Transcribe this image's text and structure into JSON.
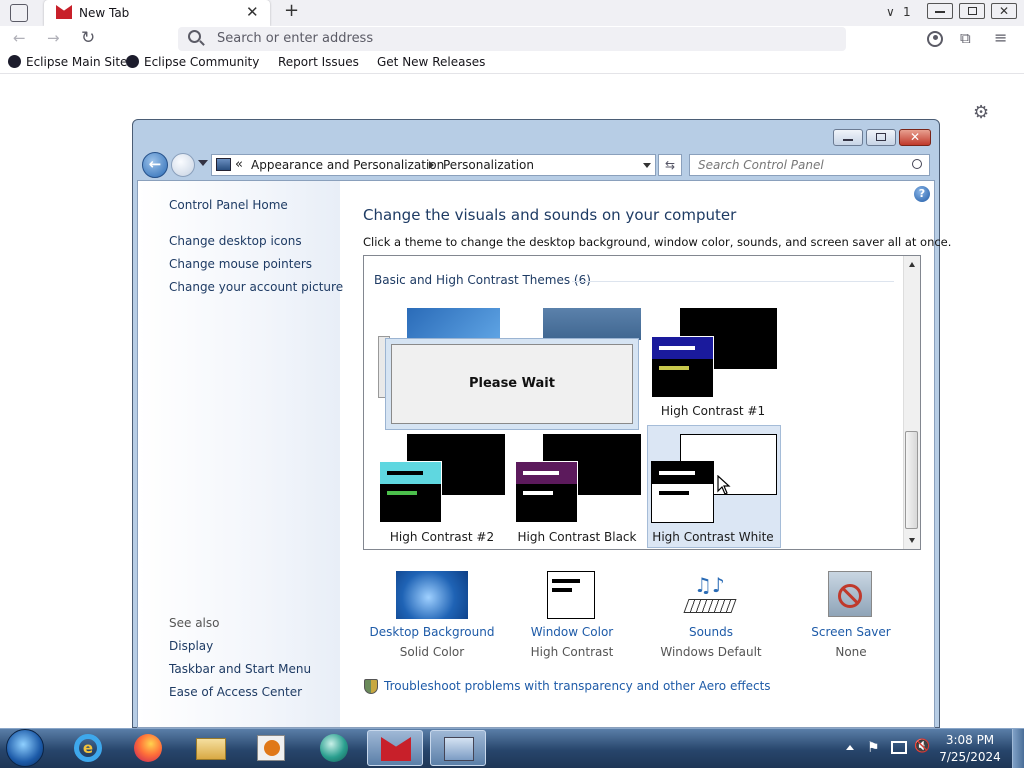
{
  "browser": {
    "tab_title": "New Tab",
    "tab_count": "1",
    "address_placeholder": "Search or enter address",
    "bookmarks": [
      "Eclipse Main Site",
      "Eclipse Community",
      "Report Issues",
      "Get New Releases"
    ]
  },
  "window": {
    "breadcrumb_sep": "«",
    "breadcrumb_1": "Appearance and Personalization",
    "breadcrumb_2": "Personalization",
    "search_placeholder": "Search Control Panel",
    "help_label": "?"
  },
  "left_pane": {
    "home": "Control Panel Home",
    "links": [
      "Change desktop icons",
      "Change mouse pointers",
      "Change your account picture"
    ],
    "see_also_title": "See also",
    "see_also": [
      "Display",
      "Taskbar and Start Menu",
      "Ease of Access Center"
    ]
  },
  "main": {
    "heading": "Change the visuals and sounds on your computer",
    "description": "Click a theme to change the desktop background, window color, sounds, and screen saver all at once.",
    "group_title": "Basic and High Contrast Themes (6)",
    "dialog_text": "Please Wait",
    "themes": [
      "High Contrast #1",
      "High Contrast #2",
      "High Contrast Black",
      "High Contrast White"
    ],
    "bottom_items": [
      {
        "link": "Desktop Background",
        "value": "Solid Color"
      },
      {
        "link": "Window Color",
        "value": "High Contrast"
      },
      {
        "link": "Sounds",
        "value": "Windows Default"
      },
      {
        "link": "Screen Saver",
        "value": "None"
      }
    ],
    "troubleshoot": "Troubleshoot problems with transparency and other Aero effects"
  },
  "taskbar": {
    "time": "3:08 PM",
    "date": "7/25/2024"
  },
  "colors": {
    "link": "#1e5ba8",
    "heading": "#1e3b64",
    "taskbar": "#27456b",
    "window_frame": "#b7cde5"
  }
}
